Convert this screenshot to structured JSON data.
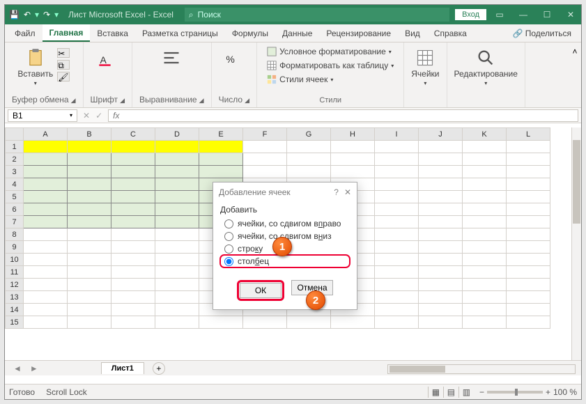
{
  "title": "Лист Microsoft Excel  -  Excel",
  "search_placeholder": "Поиск",
  "login_label": "Вход",
  "tabs": {
    "file": "Файл",
    "home": "Главная",
    "insert": "Вставка",
    "layout": "Разметка страницы",
    "formulas": "Формулы",
    "data": "Данные",
    "review": "Рецензирование",
    "view": "Вид",
    "help": "Справка"
  },
  "share_label": "Поделиться",
  "groups": {
    "clipboard_btn": "Вставить",
    "clipboard_label": "Буфер обмена",
    "font_label": "Шрифт",
    "align_label": "Выравнивание",
    "number_label": "Число",
    "styles_label": "Стили",
    "cells_label": "Ячейки",
    "editing_label": "Редактирование",
    "cond_fmt": "Условное форматирование",
    "as_table": "Форматировать как таблицу",
    "cell_styles": "Стили ячеек"
  },
  "namebox_value": "B1",
  "columns": [
    "A",
    "B",
    "C",
    "D",
    "E",
    "F",
    "G",
    "H",
    "I",
    "J",
    "K",
    "L"
  ],
  "rows": [
    "1",
    "2",
    "3",
    "4",
    "5",
    "6",
    "7",
    "8",
    "9",
    "10",
    "11",
    "12",
    "13",
    "14",
    "15"
  ],
  "dialog": {
    "title": "Добавление ячеек",
    "help": "?",
    "lead": "Добавить",
    "opt1": "ячейки, со сдвигом вправо",
    "opt2": "ячейки, со сдвигом вниз",
    "opt3": "строку",
    "opt4": "столбец",
    "ok": "ОК",
    "cancel": "Отмена"
  },
  "markers": {
    "m1": "1",
    "m2": "2"
  },
  "sheet_tab": "Лист1",
  "add_sheet": "+",
  "status": {
    "ready": "Готово",
    "scroll": "Scroll Lock"
  },
  "zoom_label": "100 %"
}
